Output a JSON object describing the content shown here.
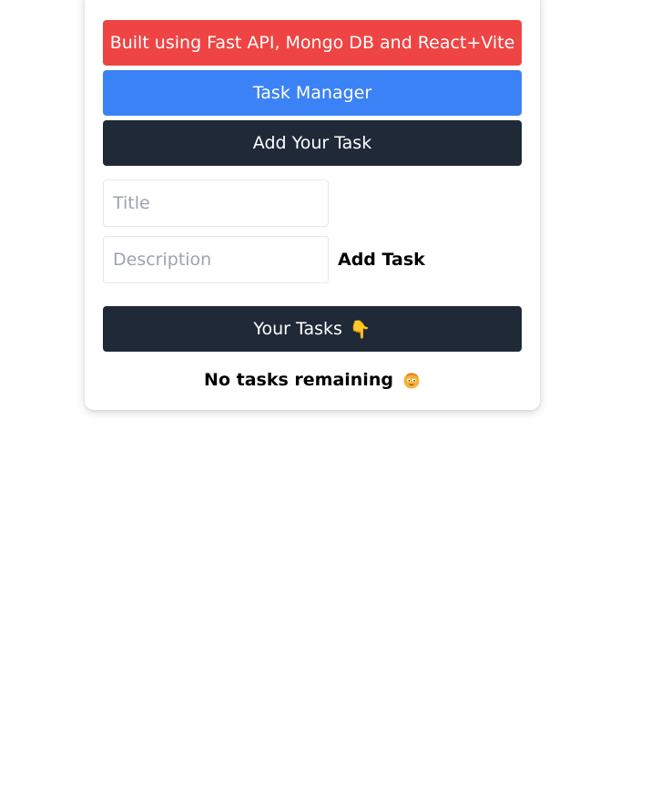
{
  "header": {
    "built_with": "Built using Fast API, Mongo DB and React+Vite",
    "app_title": "Task Manager",
    "add_section_title": "Add Your Task"
  },
  "form": {
    "title_placeholder": "Title",
    "description_placeholder": "Description",
    "submit_label": "Add Task"
  },
  "tasks": {
    "section_title": "Your Tasks",
    "section_icon": "👇",
    "empty_message": "No tasks remaining",
    "empty_icon": "relieved-face-icon"
  },
  "colors": {
    "banner_red": "#ef4444",
    "title_blue": "#3b82f6",
    "section_dark": "#1f2937"
  }
}
